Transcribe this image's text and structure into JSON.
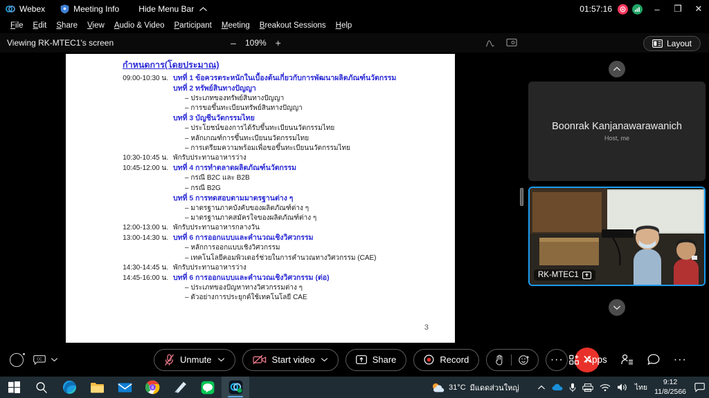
{
  "titlebar": {
    "app_name": "Webex",
    "meeting_info": "Meeting Info",
    "hide_menu_bar": "Hide Menu Bar",
    "timer": "01:57:16",
    "minimize": "–",
    "restore": "❐",
    "close": "✕",
    "record_indicator": "recording-indicator-icon",
    "signal_indicator": "network-signal-icon"
  },
  "menubar": {
    "items": [
      {
        "mnemonic": "F",
        "rest": "ile"
      },
      {
        "mnemonic": "E",
        "rest": "dit"
      },
      {
        "mnemonic": "S",
        "rest": "hare"
      },
      {
        "mnemonic": "V",
        "rest": "iew"
      },
      {
        "mnemonic": "A",
        "rest": "udio & Video"
      },
      {
        "mnemonic": "P",
        "rest": "articipant"
      },
      {
        "mnemonic": "M",
        "rest": "eeting"
      },
      {
        "mnemonic": "B",
        "rest": "reakout Sessions"
      },
      {
        "mnemonic": "H",
        "rest": "elp"
      }
    ]
  },
  "viewbar": {
    "viewing_label": "Viewing RK-MTEC1's screen",
    "zoom_out": "–",
    "zoom_value": "109%",
    "zoom_in": "+",
    "annotate_icon": "annotate-pen-icon",
    "screen_icon": "screen-capture-icon",
    "layout_label": "Layout"
  },
  "slide": {
    "title": "กำหนดการ(โดยประมาณ)",
    "page_number": "3",
    "rows": [
      {
        "time": "09:00-10:30 น.",
        "text": "บทที่ 1 ข้อควรตระหนักในเบื้องต้นเกี่ยวกับการพัฒนาผลิตภัณฑ์นวัตกรรม",
        "style": "chapter"
      },
      {
        "time": "",
        "text": "บทที่ 2 ทรัพย์สินทางปัญญา",
        "style": "chapter"
      },
      {
        "time": "",
        "text": "– ประเภทของทรัพย์สินทางปัญญา",
        "style": "bullet"
      },
      {
        "time": "",
        "text": "– การขอขึ้นทะเบียนทรัพย์สินทางปัญญา",
        "style": "bullet"
      },
      {
        "time": "",
        "text": "บทที่ 3 บัญชีนวัตกรรมไทย",
        "style": "chapter"
      },
      {
        "time": "",
        "text": "– ประโยชน์ของการได้รับขึ้นทะเบียนนวัตกรรมไทย",
        "style": "bullet"
      },
      {
        "time": "",
        "text": "– หลักเกณฑ์การขึ้นทะเบียนนวัตกรรมไทย",
        "style": "bullet"
      },
      {
        "time": "",
        "text": "– การเตรียมความพร้อมเพื่อขอขึ้นทะเบียนนวัตกรรมไทย",
        "style": "bullet"
      },
      {
        "time": "10:30-10:45 น.",
        "text": "พักรับประทานอาหารว่าง",
        "style": "break"
      },
      {
        "time": "10:45-12:00 น.",
        "text": "บทที่ 4 การทำตลาดผลิตภัณฑ์นวัตกรรม",
        "style": "chapter"
      },
      {
        "time": "",
        "text": "– กรณี B2C และ B2B",
        "style": "bullet"
      },
      {
        "time": "",
        "text": "– กรณี B2G",
        "style": "bullet"
      },
      {
        "time": "",
        "text": "บทที่ 5 การทดสอบตามมาตรฐานต่าง ๆ",
        "style": "chapter"
      },
      {
        "time": "",
        "text": "– มาตรฐานภาคบังคับของผลิตภัณฑ์ต่าง ๆ",
        "style": "bullet"
      },
      {
        "time": "",
        "text": "– มาตรฐานภาคสมัครใจของผลิตภัณฑ์ต่าง ๆ",
        "style": "bullet"
      },
      {
        "time": "12:00-13:00 น.",
        "text": "พักรับประทานอาหารกลางวัน",
        "style": "break"
      },
      {
        "time": "13:00-14:30 น.",
        "text": "บทที่ 6 การออกแบบและคำนวณเชิงวิศวกรรม",
        "style": "chapter"
      },
      {
        "time": "",
        "text": "– หลักการออกแบบเชิงวิศวกรรม",
        "style": "bullet"
      },
      {
        "time": "",
        "text": "– เทคโนโลยีคอมพิวเตอร์ช่วยในการคำนวณทางวิศวกรรม (CAE)",
        "style": "bullet"
      },
      {
        "time": "14:30-14:45 น.",
        "text": "พักรับประทานอาหารว่าง",
        "style": "break"
      },
      {
        "time": "14:45-16:00 น.",
        "text": "บทที่ 6 การออกแบบและคำนวณเชิงวิศวกรรม (ต่อ)",
        "style": "chapter"
      },
      {
        "time": "",
        "text": "– ประเภทของปัญหาทางวิศวกรรมต่าง ๆ",
        "style": "bullet"
      },
      {
        "time": "",
        "text": "– ตัวอย่างการประยุกต์ใช้เทคโนโลยี CAE",
        "style": "bullet"
      }
    ]
  },
  "panel": {
    "scroll_up_icon": "chevron-up-icon",
    "scroll_down_icon": "chevron-down-icon",
    "participants": [
      {
        "name": "Boonrak Kanjanawarawanich",
        "role": "Host, me"
      },
      {
        "name": "RK-MTEC1",
        "badge_icon": "screen-share-icon"
      }
    ]
  },
  "controls": {
    "record_circle_icon": "recording-status-icon",
    "captions_icon": "closed-captions-icon",
    "captions_chevron": "chevron-down-icon",
    "mute_label": "Unmute",
    "mute_icon": "microphone-muted-icon",
    "mute_chevron": "chevron-down-icon",
    "video_label": "Start video",
    "video_icon": "camera-off-icon",
    "video_chevron": "chevron-down-icon",
    "share_label": "Share",
    "share_icon": "share-screen-icon",
    "record_label": "Record",
    "record_icon": "record-dot-icon",
    "raise_hand_icon": "raise-hand-icon",
    "reactions_icon": "emoji-reaction-icon",
    "more_options": "···",
    "end_meeting_icon": "✕",
    "apps_label": "Apps",
    "apps_icon": "apps-grid-icon",
    "participants_icon": "participants-list-icon",
    "chat_icon": "chat-bubble-icon",
    "more_icon": "···",
    "danger_color": "#f87f8f",
    "end_color": "#e8312a"
  },
  "taskbar": {
    "items": [
      {
        "name": "start-button",
        "icon": "windows-logo-icon",
        "active": false,
        "running": false
      },
      {
        "name": "search-button",
        "icon": "search-icon",
        "active": false,
        "running": false
      },
      {
        "name": "edge-button",
        "icon": "microsoft-edge-icon",
        "active": false,
        "running": true
      },
      {
        "name": "file-explorer-button",
        "icon": "file-explorer-icon",
        "active": false,
        "running": true
      },
      {
        "name": "mail-button",
        "icon": "mail-icon",
        "active": false,
        "running": false
      },
      {
        "name": "chrome-button",
        "icon": "google-chrome-icon",
        "active": false,
        "running": true
      },
      {
        "name": "sticky-notes-button",
        "icon": "sticky-notes-icon",
        "active": false,
        "running": true
      },
      {
        "name": "line-button",
        "icon": "line-app-icon",
        "active": false,
        "running": true
      },
      {
        "name": "webex-button",
        "icon": "webex-app-icon",
        "active": true,
        "running": true
      }
    ],
    "weather_temp": "31°C",
    "weather_desc": "มีแดดส่วนใหญ่",
    "weather_icon": "partly-sunny-icon",
    "tray_chevron": "chevron-up-icon",
    "tray_icons": [
      "onedrive-icon",
      "microphone-icon",
      "printer-icon",
      "wifi-icon",
      "volume-icon"
    ],
    "language": "ไทย",
    "time": "9:12",
    "date": "11/8/2566",
    "notification_icon": "notification-icon"
  }
}
